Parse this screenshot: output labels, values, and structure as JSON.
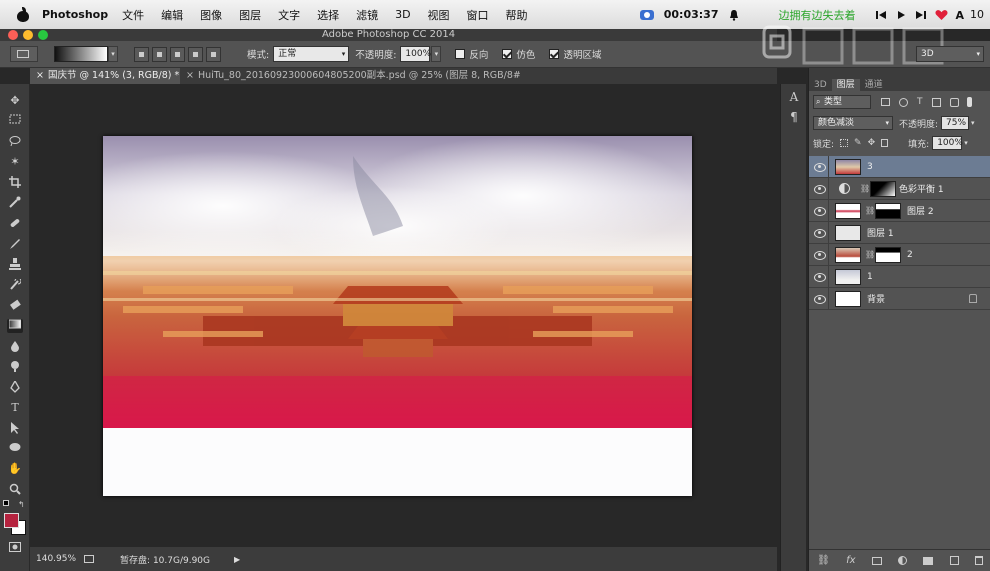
{
  "menubar": {
    "app_name": "Photoshop",
    "items": [
      "文件",
      "编辑",
      "图像",
      "图层",
      "文字",
      "选择",
      "滤镜",
      "3D",
      "视图",
      "窗口",
      "帮助"
    ],
    "clock": "00:03:37",
    "promo": "边拥有边失去着",
    "battery": "10"
  },
  "window": {
    "title": "Adobe Photoshop CC 2014"
  },
  "options": {
    "mode_label": "模式:",
    "mode_value": "正常",
    "opacity_label": "不透明度:",
    "opacity_value": "100%",
    "reverse_label": "反向",
    "dither_label": "仿色",
    "transparency_label": "透明区域",
    "workspace": "3D"
  },
  "tabs": [
    {
      "close": "×",
      "label": "国庆节 @ 141% (3, RGB/8) *"
    },
    {
      "close": "×",
      "label": "HuiTu_80_20160923000604805200副本.psd @ 25% (图层 8, RGB/8#) *"
    }
  ],
  "status": {
    "zoom": "140.95%",
    "scratch": "暂存盘: 10.7G/9.90G"
  },
  "panel": {
    "tabs": [
      "3D",
      "图层",
      "通道"
    ],
    "filter_kind": "类型",
    "blend_mode": "颜色减淡",
    "opacity_label": "不透明度:",
    "opacity_value": "75%",
    "lock_label": "锁定:",
    "fill_label": "填充:",
    "fill_value": "100%",
    "layers": [
      {
        "name": "3"
      },
      {
        "name": "色彩平衡 1"
      },
      {
        "name": "图层 2"
      },
      {
        "name": "图层 1"
      },
      {
        "name": "2"
      },
      {
        "name": "1"
      },
      {
        "name": "背景"
      }
    ]
  },
  "colors": {
    "foreground": "#b5233f",
    "background": "#ffffff",
    "selected_layer": "#6c7c93",
    "promo": "#2aa52a"
  }
}
